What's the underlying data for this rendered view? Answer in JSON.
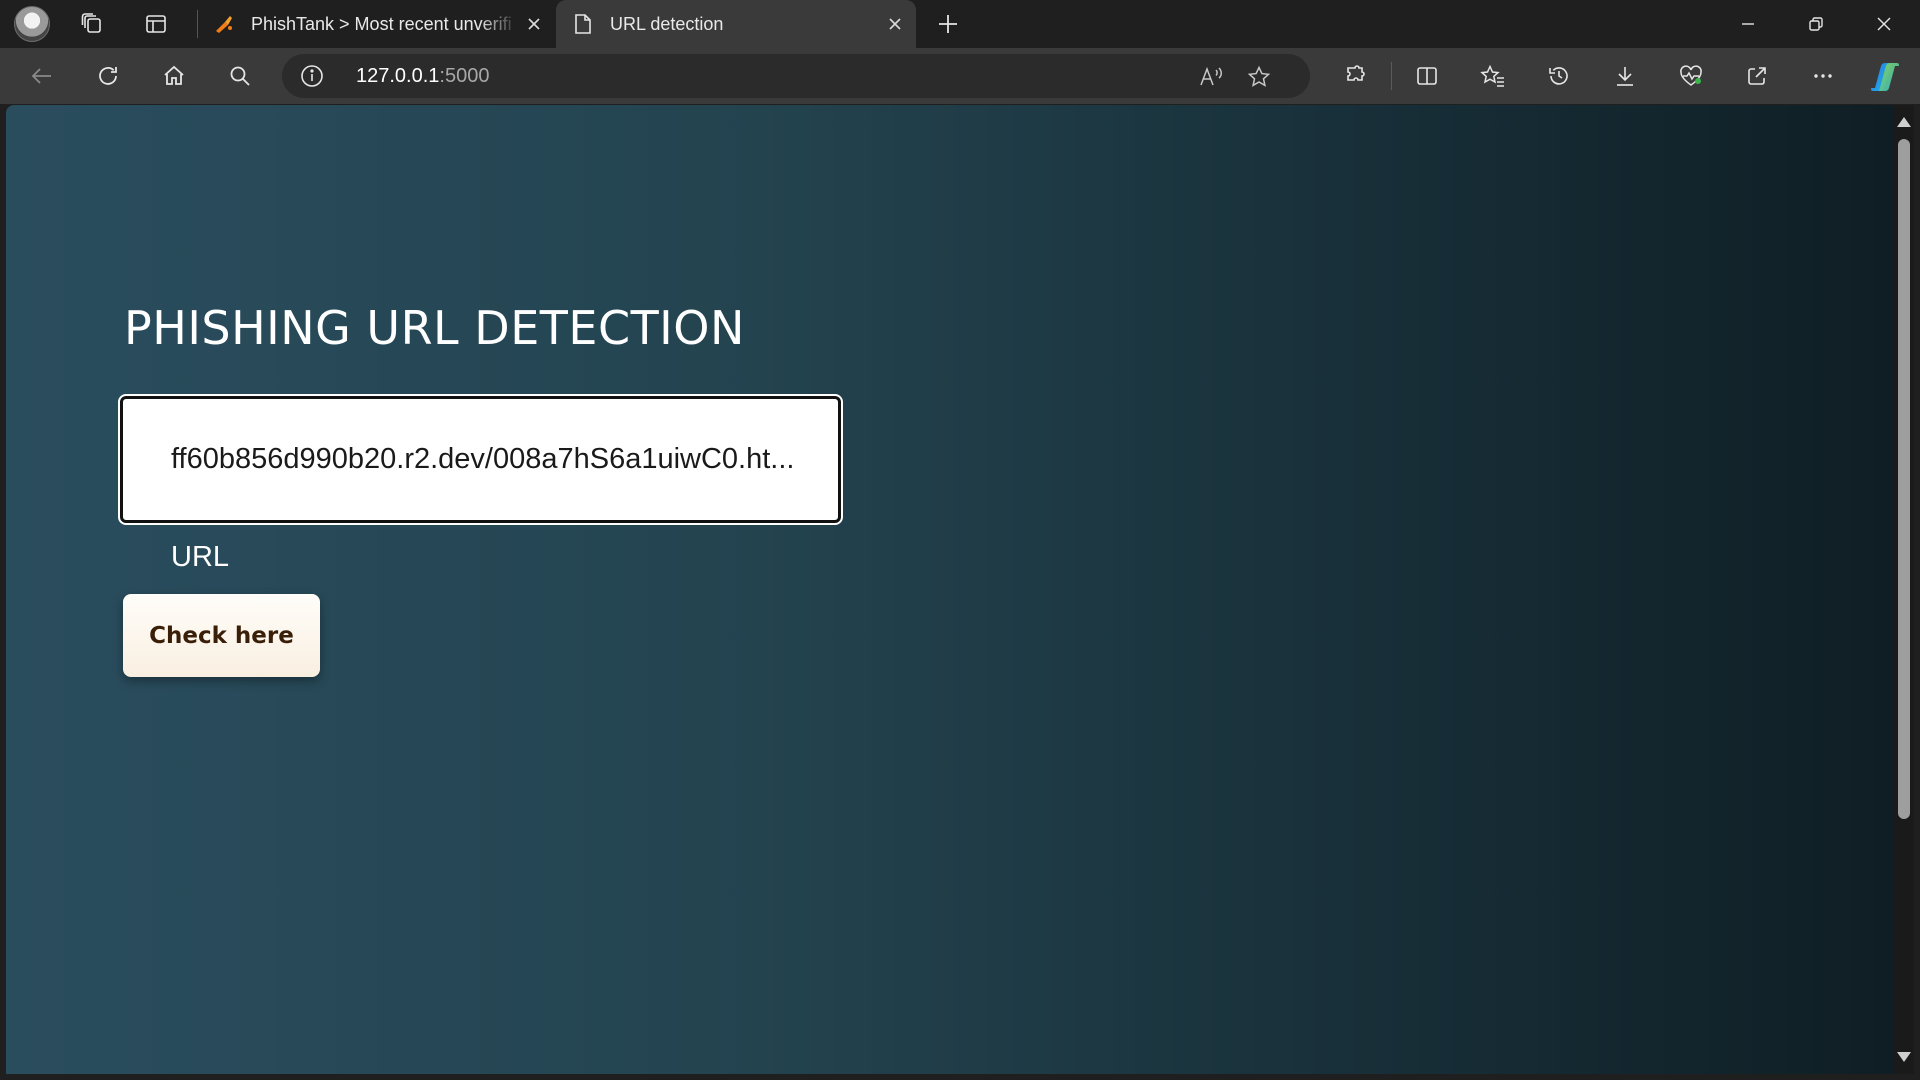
{
  "browser": {
    "tabs": [
      {
        "title": "PhishTank > Most recent unverifi",
        "icon": "phishtank-favicon-icon",
        "active": false
      },
      {
        "title": "URL detection",
        "icon": "page-icon",
        "active": true
      }
    ],
    "address": {
      "host": "127.0.0.1",
      "port": ":5000"
    },
    "colors": {
      "frame": "#1f1f1f",
      "toolbar": "#3a3a3a",
      "omnibox": "#2b2b2b"
    }
  },
  "page": {
    "title": "PHISHING URL DETECTION",
    "url_input_value": "ff60b856d990b20.r2.dev/008a7hS6a1uiwC0.ht...",
    "url_label": "URL",
    "check_button": "Check here",
    "colors": {
      "bg_left": "#2a4d5e",
      "bg_right": "#0f1e24",
      "button_text": "#3a1f08"
    }
  }
}
